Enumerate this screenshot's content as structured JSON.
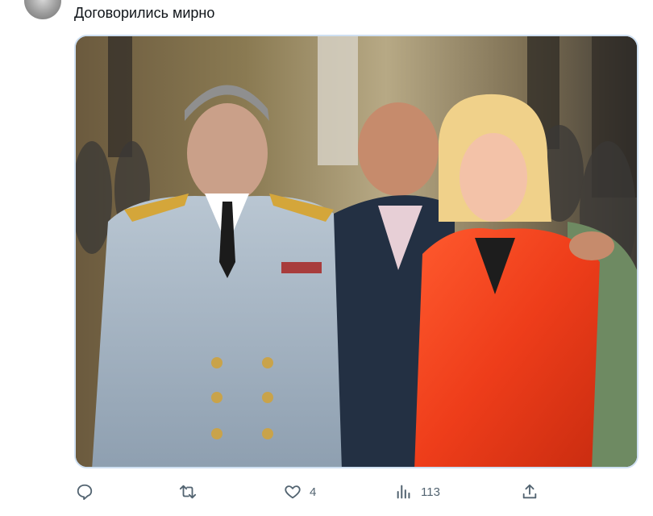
{
  "tweet": {
    "text": "Договорились мирно"
  },
  "actions": {
    "reply": {
      "icon": "reply-icon",
      "count": ""
    },
    "retweet": {
      "icon": "retweet-icon",
      "count": ""
    },
    "like": {
      "icon": "heart-icon",
      "count": "4"
    },
    "views": {
      "icon": "views-chart-icon",
      "count": "113"
    },
    "share": {
      "icon": "share-icon",
      "count": ""
    }
  },
  "colors": {
    "icon": "#536471",
    "media_border": "#cfe0f2"
  }
}
